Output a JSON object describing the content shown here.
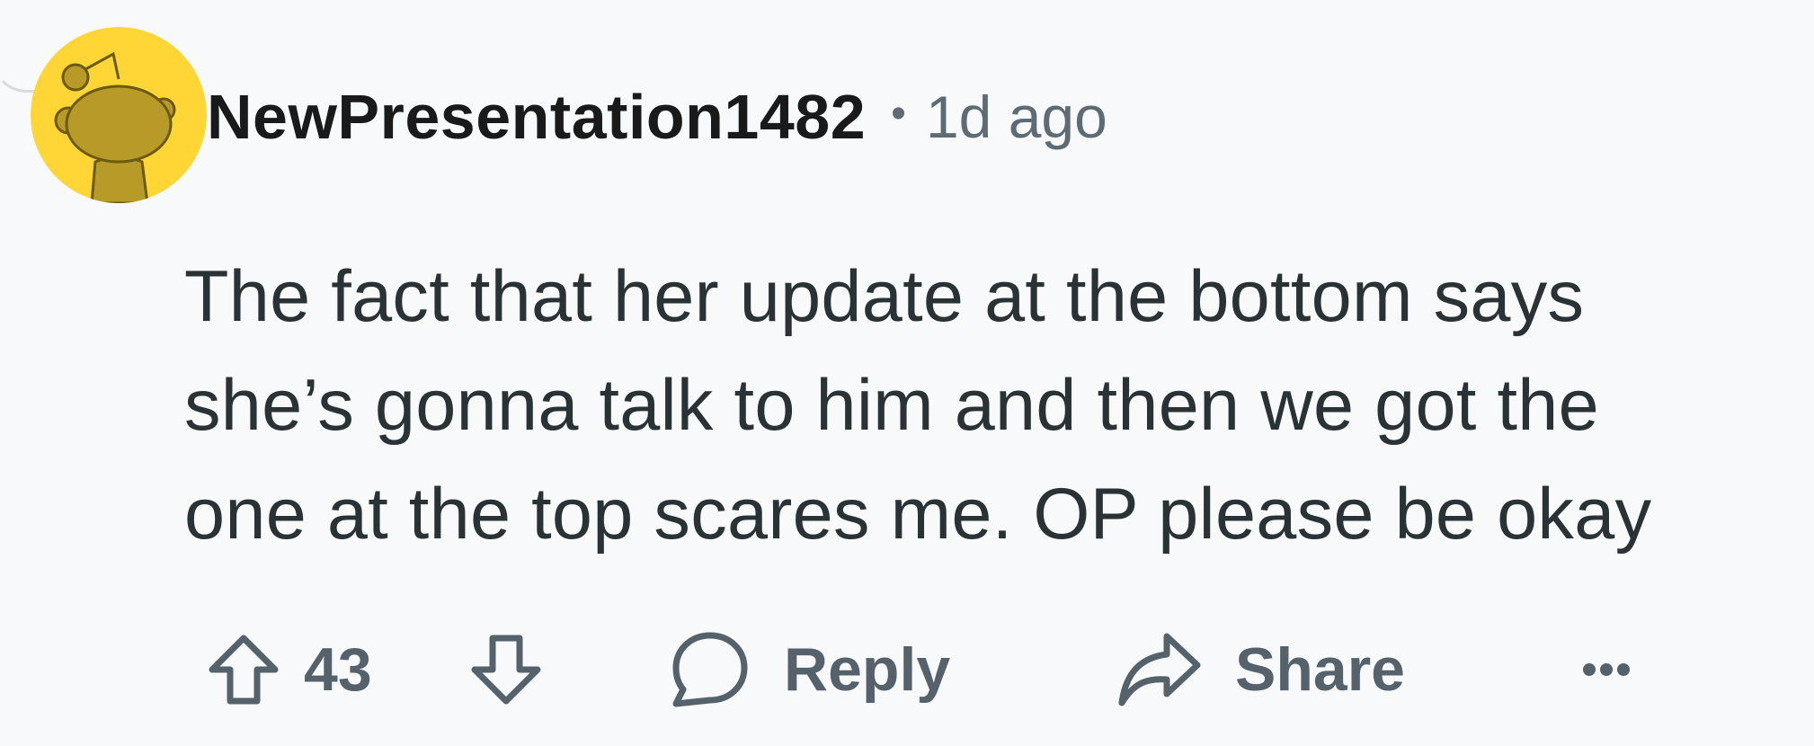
{
  "comment": {
    "author": "NewPresentation1482",
    "separator": "•",
    "timestamp": "1d ago",
    "body_lines": [
      "The fact that her update at the bottom says",
      "she’s gonna talk to him and then we got the",
      "one at the top scares me. OP please be okay"
    ]
  },
  "actions": {
    "upvote_icon": "arrow-up-icon",
    "score": "43",
    "downvote_icon": "arrow-down-icon",
    "reply_icon": "speech-bubble-icon",
    "reply_label": "Reply",
    "share_icon": "share-arrow-icon",
    "share_label": "Share",
    "more_icon": "ellipsis-icon"
  },
  "colors": {
    "background": "#f7f9fa",
    "avatar_bg": "#ffd635",
    "avatar_figure": "#b79a28",
    "text": "#2a3236",
    "muted": "#55626b"
  }
}
